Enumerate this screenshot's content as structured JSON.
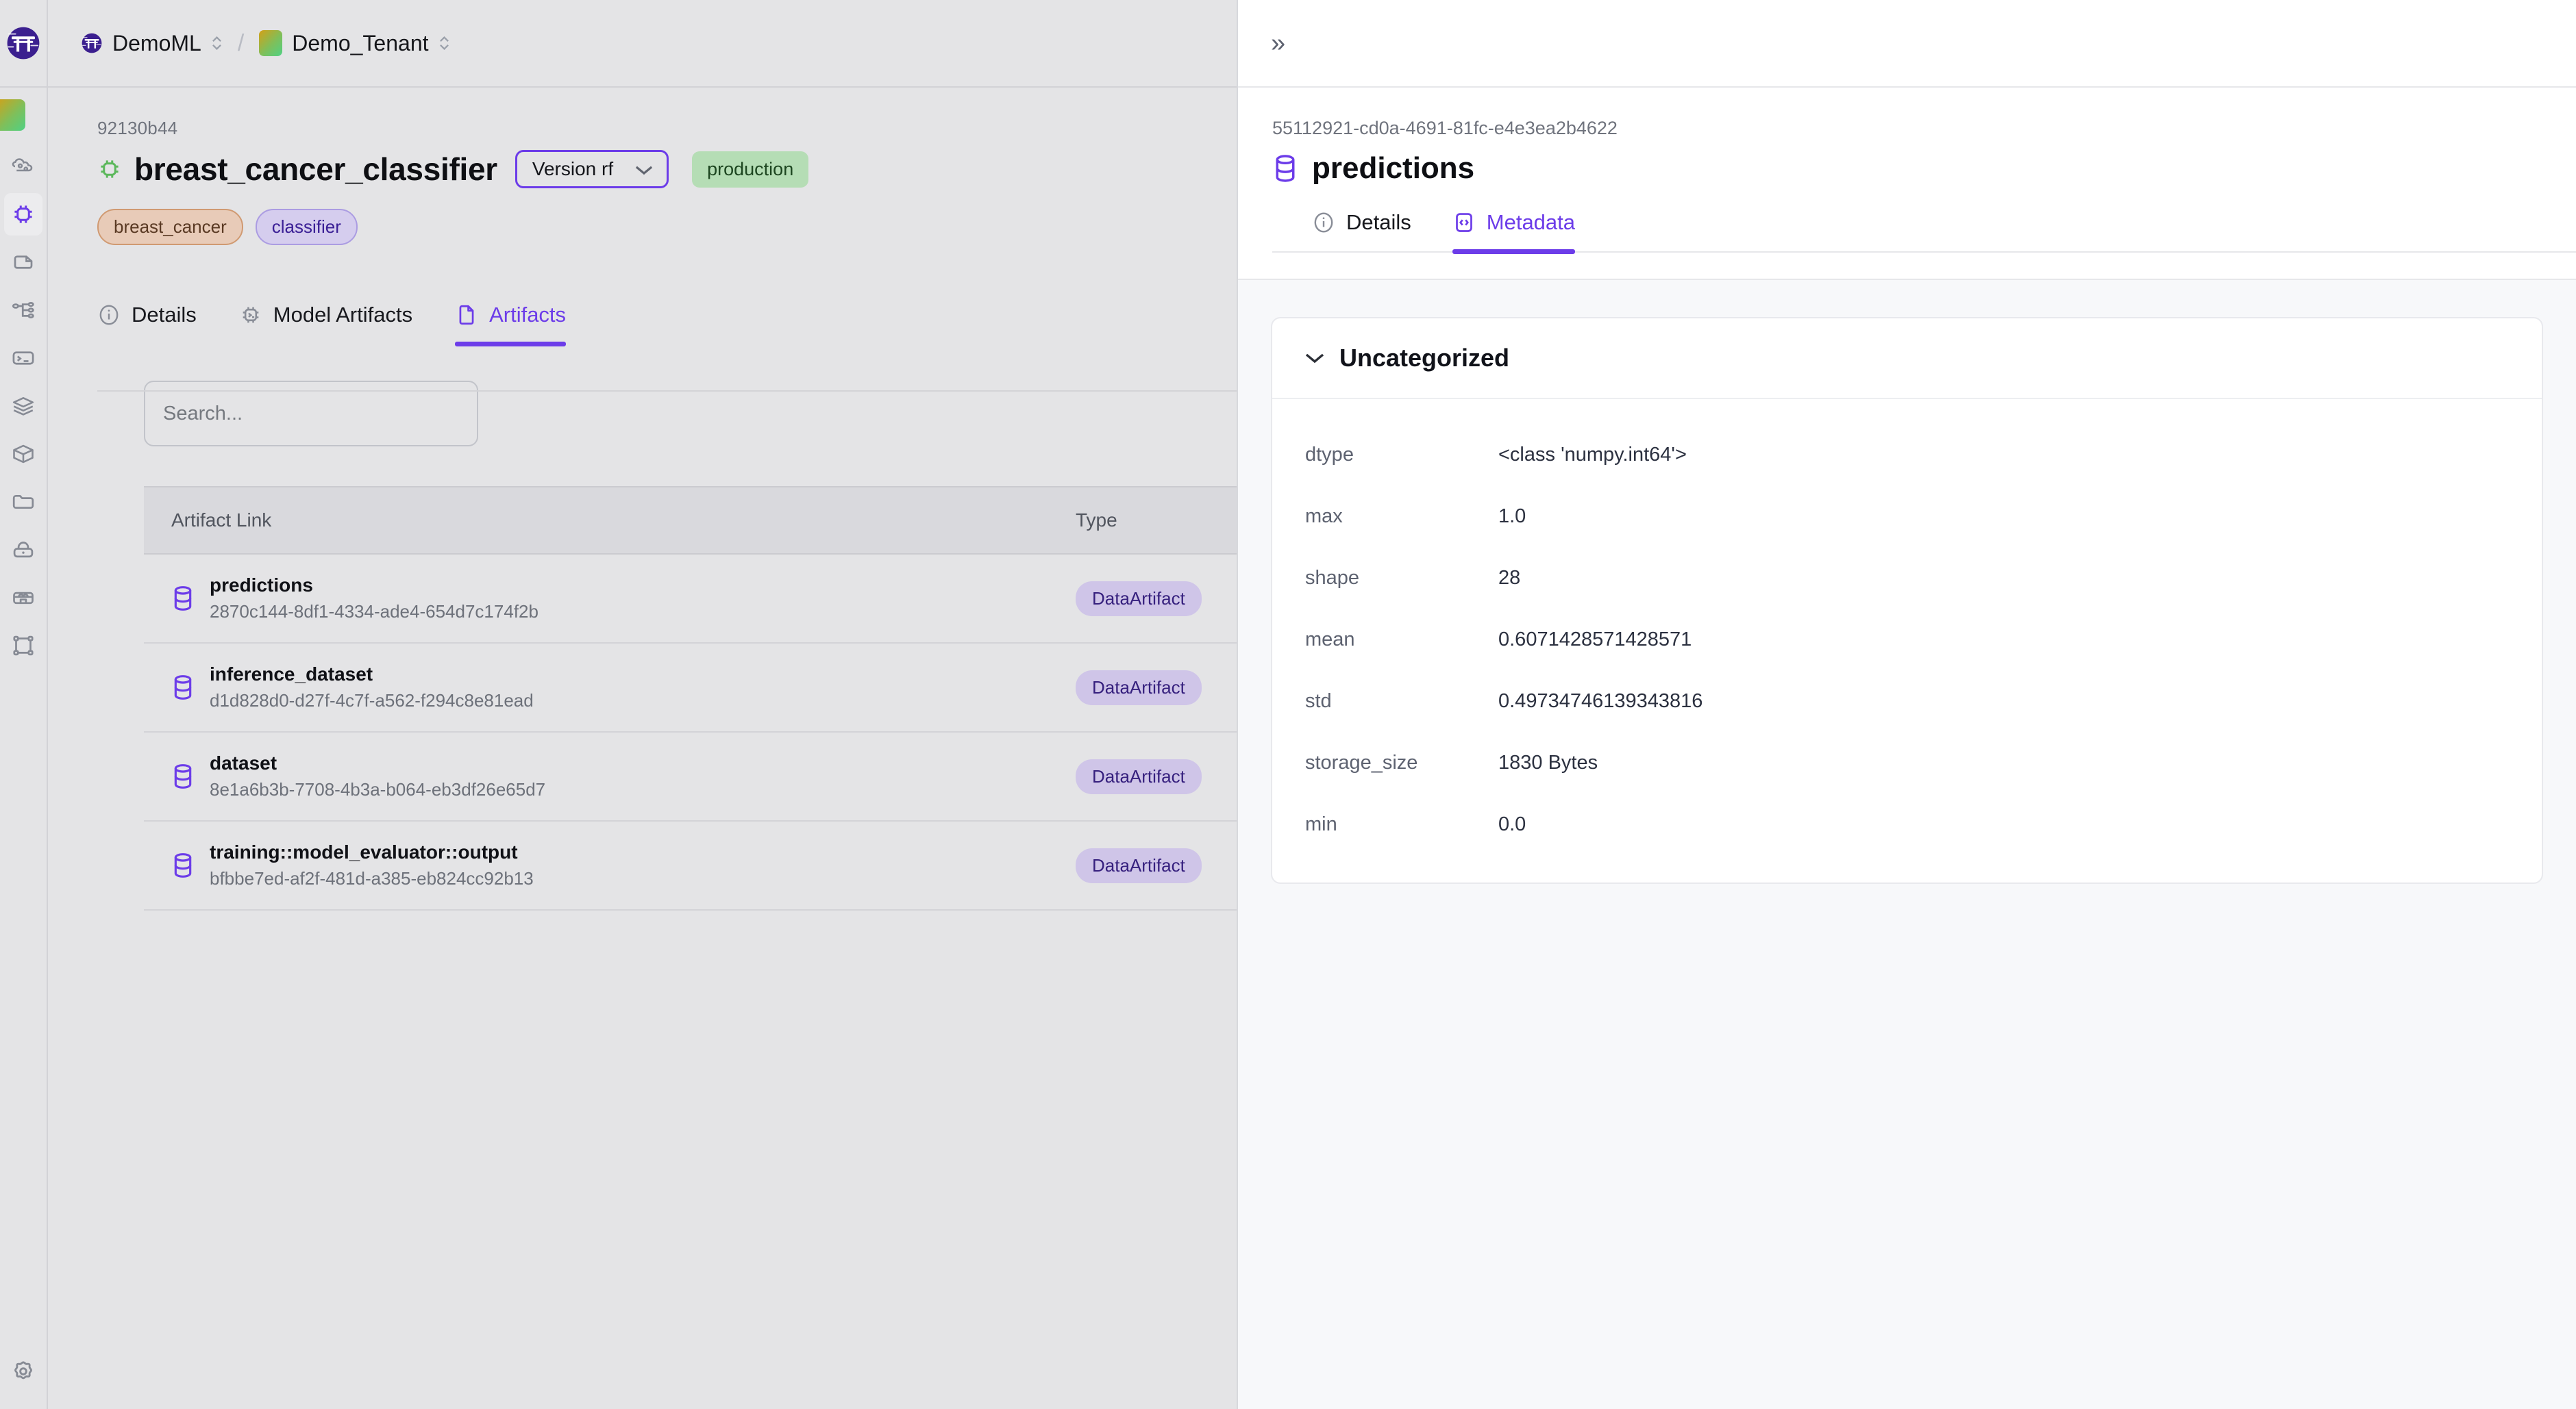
{
  "app": {
    "logo_icon": "torii-gate-logo",
    "tenant_swatch_icon": "tenant-color-swatch"
  },
  "sidebar": {
    "items": [
      {
        "icon": "pipeline-cloud-icon",
        "name": "pipelines",
        "active": false
      },
      {
        "icon": "chip-model-icon",
        "name": "models",
        "active": true
      },
      {
        "icon": "document-icon",
        "name": "artifacts",
        "active": false
      },
      {
        "icon": "hierarchy-tree-icon",
        "name": "lineage",
        "active": false
      },
      {
        "icon": "terminal-icon",
        "name": "runs",
        "active": false
      },
      {
        "icon": "layers-stack-icon",
        "name": "stacks",
        "active": false
      },
      {
        "icon": "package-box-icon",
        "name": "components",
        "active": false
      },
      {
        "icon": "folder-icon",
        "name": "projects",
        "active": false
      },
      {
        "icon": "lock-icon",
        "name": "secrets",
        "active": false
      },
      {
        "icon": "server-bank-icon",
        "name": "service-connectors",
        "active": false
      },
      {
        "icon": "bounding-box-icon",
        "name": "deployments",
        "active": false
      }
    ],
    "settings_icon": "gear-icon"
  },
  "topbar": {
    "workspace": "DemoML",
    "workspace_icon": "torii-gate-logo",
    "separator": "/",
    "tenant": "Demo_Tenant",
    "selector_icon": "chevron-updown-icon"
  },
  "model": {
    "id": "92130b44",
    "icon": "chip-model-icon",
    "name": "breast_cancer_classifier",
    "version_label": "Version rf",
    "version_caret_icon": "chevron-down-icon",
    "stage_badge": "production",
    "tags": [
      {
        "label": "breast_cancer",
        "style": "peach"
      },
      {
        "label": "classifier",
        "style": "lilac"
      }
    ]
  },
  "tabs": [
    {
      "label": "Details",
      "icon": "info-circle-icon",
      "active": false
    },
    {
      "label": "Model Artifacts",
      "icon": "chip-model-icon",
      "active": false
    },
    {
      "label": "Artifacts",
      "icon": "document-icon",
      "active": true
    }
  ],
  "search": {
    "placeholder": "Search...",
    "value": "",
    "icon": "search-input"
  },
  "table": {
    "columns": [
      "Artifact Link",
      "Type"
    ],
    "rows": [
      {
        "icon": "database-icon",
        "name": "predictions",
        "uuid": "2870c144-8df1-4334-ade4-654d7c174f2b",
        "type": "DataArtifact"
      },
      {
        "icon": "database-icon",
        "name": "inference_dataset",
        "uuid": "d1d828d0-d27f-4c7f-a562-f294c8e81ead",
        "type": "DataArtifact"
      },
      {
        "icon": "database-icon",
        "name": "dataset",
        "uuid": "8e1a6b3b-7708-4b3a-b064-eb3df26e65d7",
        "type": "DataArtifact"
      },
      {
        "icon": "database-icon",
        "name": "training::model_evaluator::output",
        "uuid": "bfbbe7ed-af2f-481d-a385-eb824cc92b13",
        "type": "DataArtifact"
      }
    ]
  },
  "drawer": {
    "collapse_icon": "chevrons-right-icon",
    "collapse_glyph": "»",
    "artifact_id": "55112921-cd0a-4691-81fc-e4e3ea2b4622",
    "title_icon": "database-icon",
    "title": "predictions",
    "tabs": [
      {
        "label": "Details",
        "icon": "info-circle-icon",
        "active": false
      },
      {
        "label": "Metadata",
        "icon": "code-brackets-icon",
        "active": true
      }
    ],
    "metadata_group": {
      "title": "Uncategorized",
      "caret_icon": "chevron-down-icon",
      "rows": [
        {
          "key": "dtype",
          "value": "<class 'numpy.int64'>"
        },
        {
          "key": "max",
          "value": "1.0"
        },
        {
          "key": "shape",
          "value": "28"
        },
        {
          "key": "mean",
          "value": "0.6071428571428571"
        },
        {
          "key": "std",
          "value": "0.49734746139343816"
        },
        {
          "key": "storage_size",
          "value": "1830 Bytes"
        },
        {
          "key": "min",
          "value": "0.0"
        }
      ]
    }
  },
  "colors": {
    "accent": "#6c3ce9",
    "page_bg": "#e4e4e6",
    "drawer_bg": "#f7f8fa",
    "badge_lilac": "#cfc5e8",
    "badge_green": "#b5ddb5",
    "tag_peach": "#e8cbb8",
    "model_icon_green": "#5cb85c"
  }
}
